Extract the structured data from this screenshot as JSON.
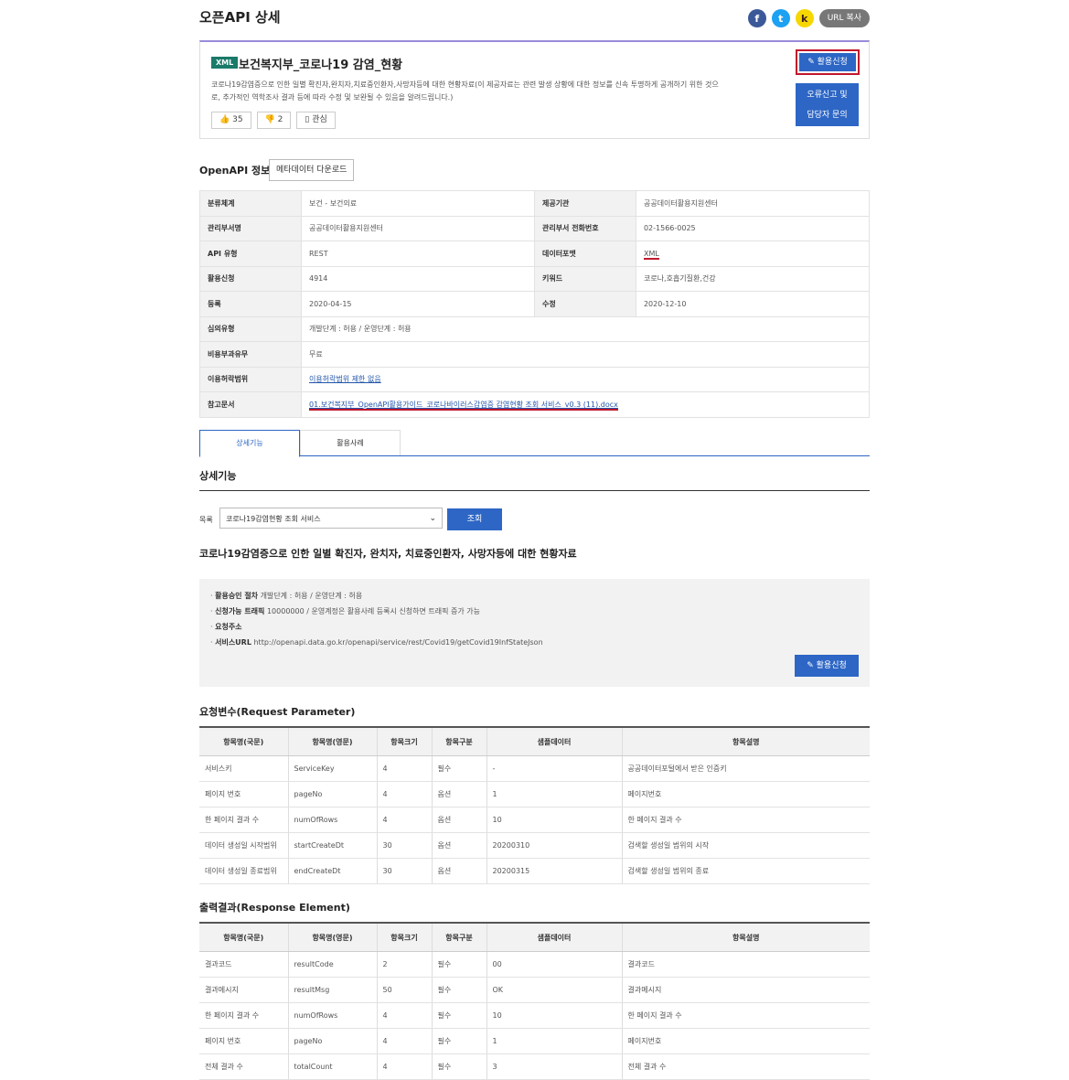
{
  "page_title": "오픈API 상세",
  "share": {
    "facebook": "f",
    "twitter": "t",
    "kakao": "k",
    "url_copy": "URL 복사"
  },
  "summary": {
    "format_badge": "XML",
    "api_name": "보건복지부_코로나19 감염_현황",
    "description": "코로나19감염증으로 인한 일별 확진자,완치자,치료중인환자,사망자등에 대한 현황자료(이 제공자료는 관련 발생 상황에 대한 정보를 신속 투명하게 공개하기 위한 것으로, 추가적인 역학조사 결과 등에 따라 수정 및 보완될 수 있음을 알려드립니다.)",
    "like_count": "35",
    "dislike_count": "2",
    "bookmark_label": "관심",
    "apply_label": "활용신청",
    "error_report_line1": "오류신고 및",
    "error_report_line2": "담당자 문의"
  },
  "openapi_info": {
    "section_title": "OpenAPI 정보",
    "metadata_download": "메타데이터 다운로드",
    "rows": [
      {
        "l1": "분류체계",
        "v1": "보건 - 보건의료",
        "l2": "제공기관",
        "v2": "공공데이터활용지원센터"
      },
      {
        "l1": "관리부서명",
        "v1": "공공데이터활용지원센터",
        "l2": "관리부서 전화번호",
        "v2": "02-1566-0025"
      },
      {
        "l1": "API 유형",
        "v1": "REST",
        "l2": "데이터포맷",
        "v2": "XML"
      },
      {
        "l1": "활용신청",
        "v1": "4914",
        "l2": "키워드",
        "v2": "코로나,호흡기질환,건강"
      },
      {
        "l1": "등록",
        "v1": "2020-04-15",
        "l2": "수정",
        "v2": "2020-12-10"
      }
    ],
    "approval_label": "심의유형",
    "approval_value": "개발단계 : 허용 / 운영단계 : 허용",
    "fee_label": "비용부과유무",
    "fee_value": "무료",
    "license_label": "이용허락범위",
    "license_value": "이용허락범위 제한 없음",
    "ref_label": "참고문서",
    "ref_value": "01.보건복지부_OpenAPI활용가이드_코로나바이러스감염증 감염현황 조회 서비스_v0.3 (11).docx"
  },
  "tabs": [
    "상세기능",
    "활용사례"
  ],
  "detail": {
    "section_title": "상세기능",
    "list_label": "목록",
    "selected_service": "코로나19감염현황 조회 서비스",
    "query_button": "조회",
    "service_title": "코로나19감염증으로 인한 일별 확진자, 완치자, 치료중인환자, 사망자등에 대한 현황자료",
    "bullets": [
      {
        "key": "활용승인 절차",
        "value": "개발단계 : 허용 / 운영단계 : 허용"
      },
      {
        "key": "신청가능 트래픽",
        "value": "10000000 / 운영계정은 활용사례 등록시 신청하면 트래픽 증가 가능"
      },
      {
        "key": "요청주소",
        "value": ""
      },
      {
        "key": "서비스URL",
        "value": "http://openapi.data.go.kr/openapi/service/rest/Covid19/getCovid19InfStateJson"
      }
    ],
    "apply_label": "활용신청"
  },
  "request": {
    "title": "요청변수(Request Parameter)",
    "headers": [
      "항목명(국문)",
      "항목명(영문)",
      "항목크기",
      "항목구분",
      "샘플데이터",
      "항목설명"
    ],
    "rows": [
      [
        "서비스키",
        "ServiceKey",
        "4",
        "필수",
        "-",
        "공공데이터포털에서 받은 인증키"
      ],
      [
        "페이지 번호",
        "pageNo",
        "4",
        "옵션",
        "1",
        "페이지번호"
      ],
      [
        "한 페이지 결과 수",
        "numOfRows",
        "4",
        "옵션",
        "10",
        "한 페이지 결과 수"
      ],
      [
        "데이터 생성일 시작범위",
        "startCreateDt",
        "30",
        "옵션",
        "20200310",
        "검색할 생성일 범위의 시작"
      ],
      [
        "데이터 생성일 종료범위",
        "endCreateDt",
        "30",
        "옵션",
        "20200315",
        "검색할 생성일 범위의 종료"
      ]
    ]
  },
  "response": {
    "title": "출력결과(Response Element)",
    "headers": [
      "항목명(국문)",
      "항목명(영문)",
      "항목크기",
      "항목구분",
      "샘플데이터",
      "항목설명"
    ],
    "rows": [
      [
        "결과코드",
        "resultCode",
        "2",
        "필수",
        "00",
        "결과코드"
      ],
      [
        "결과메시지",
        "resultMsg",
        "50",
        "필수",
        "OK",
        "결과메시지"
      ],
      [
        "한 페이지 결과 수",
        "numOfRows",
        "4",
        "필수",
        "10",
        "한 페이지 결과 수"
      ],
      [
        "페이지 번호",
        "pageNo",
        "4",
        "필수",
        "1",
        "페이지번호"
      ],
      [
        "전체 결과 수",
        "totalCount",
        "4",
        "필수",
        "3",
        "전체 결과 수"
      ]
    ]
  }
}
